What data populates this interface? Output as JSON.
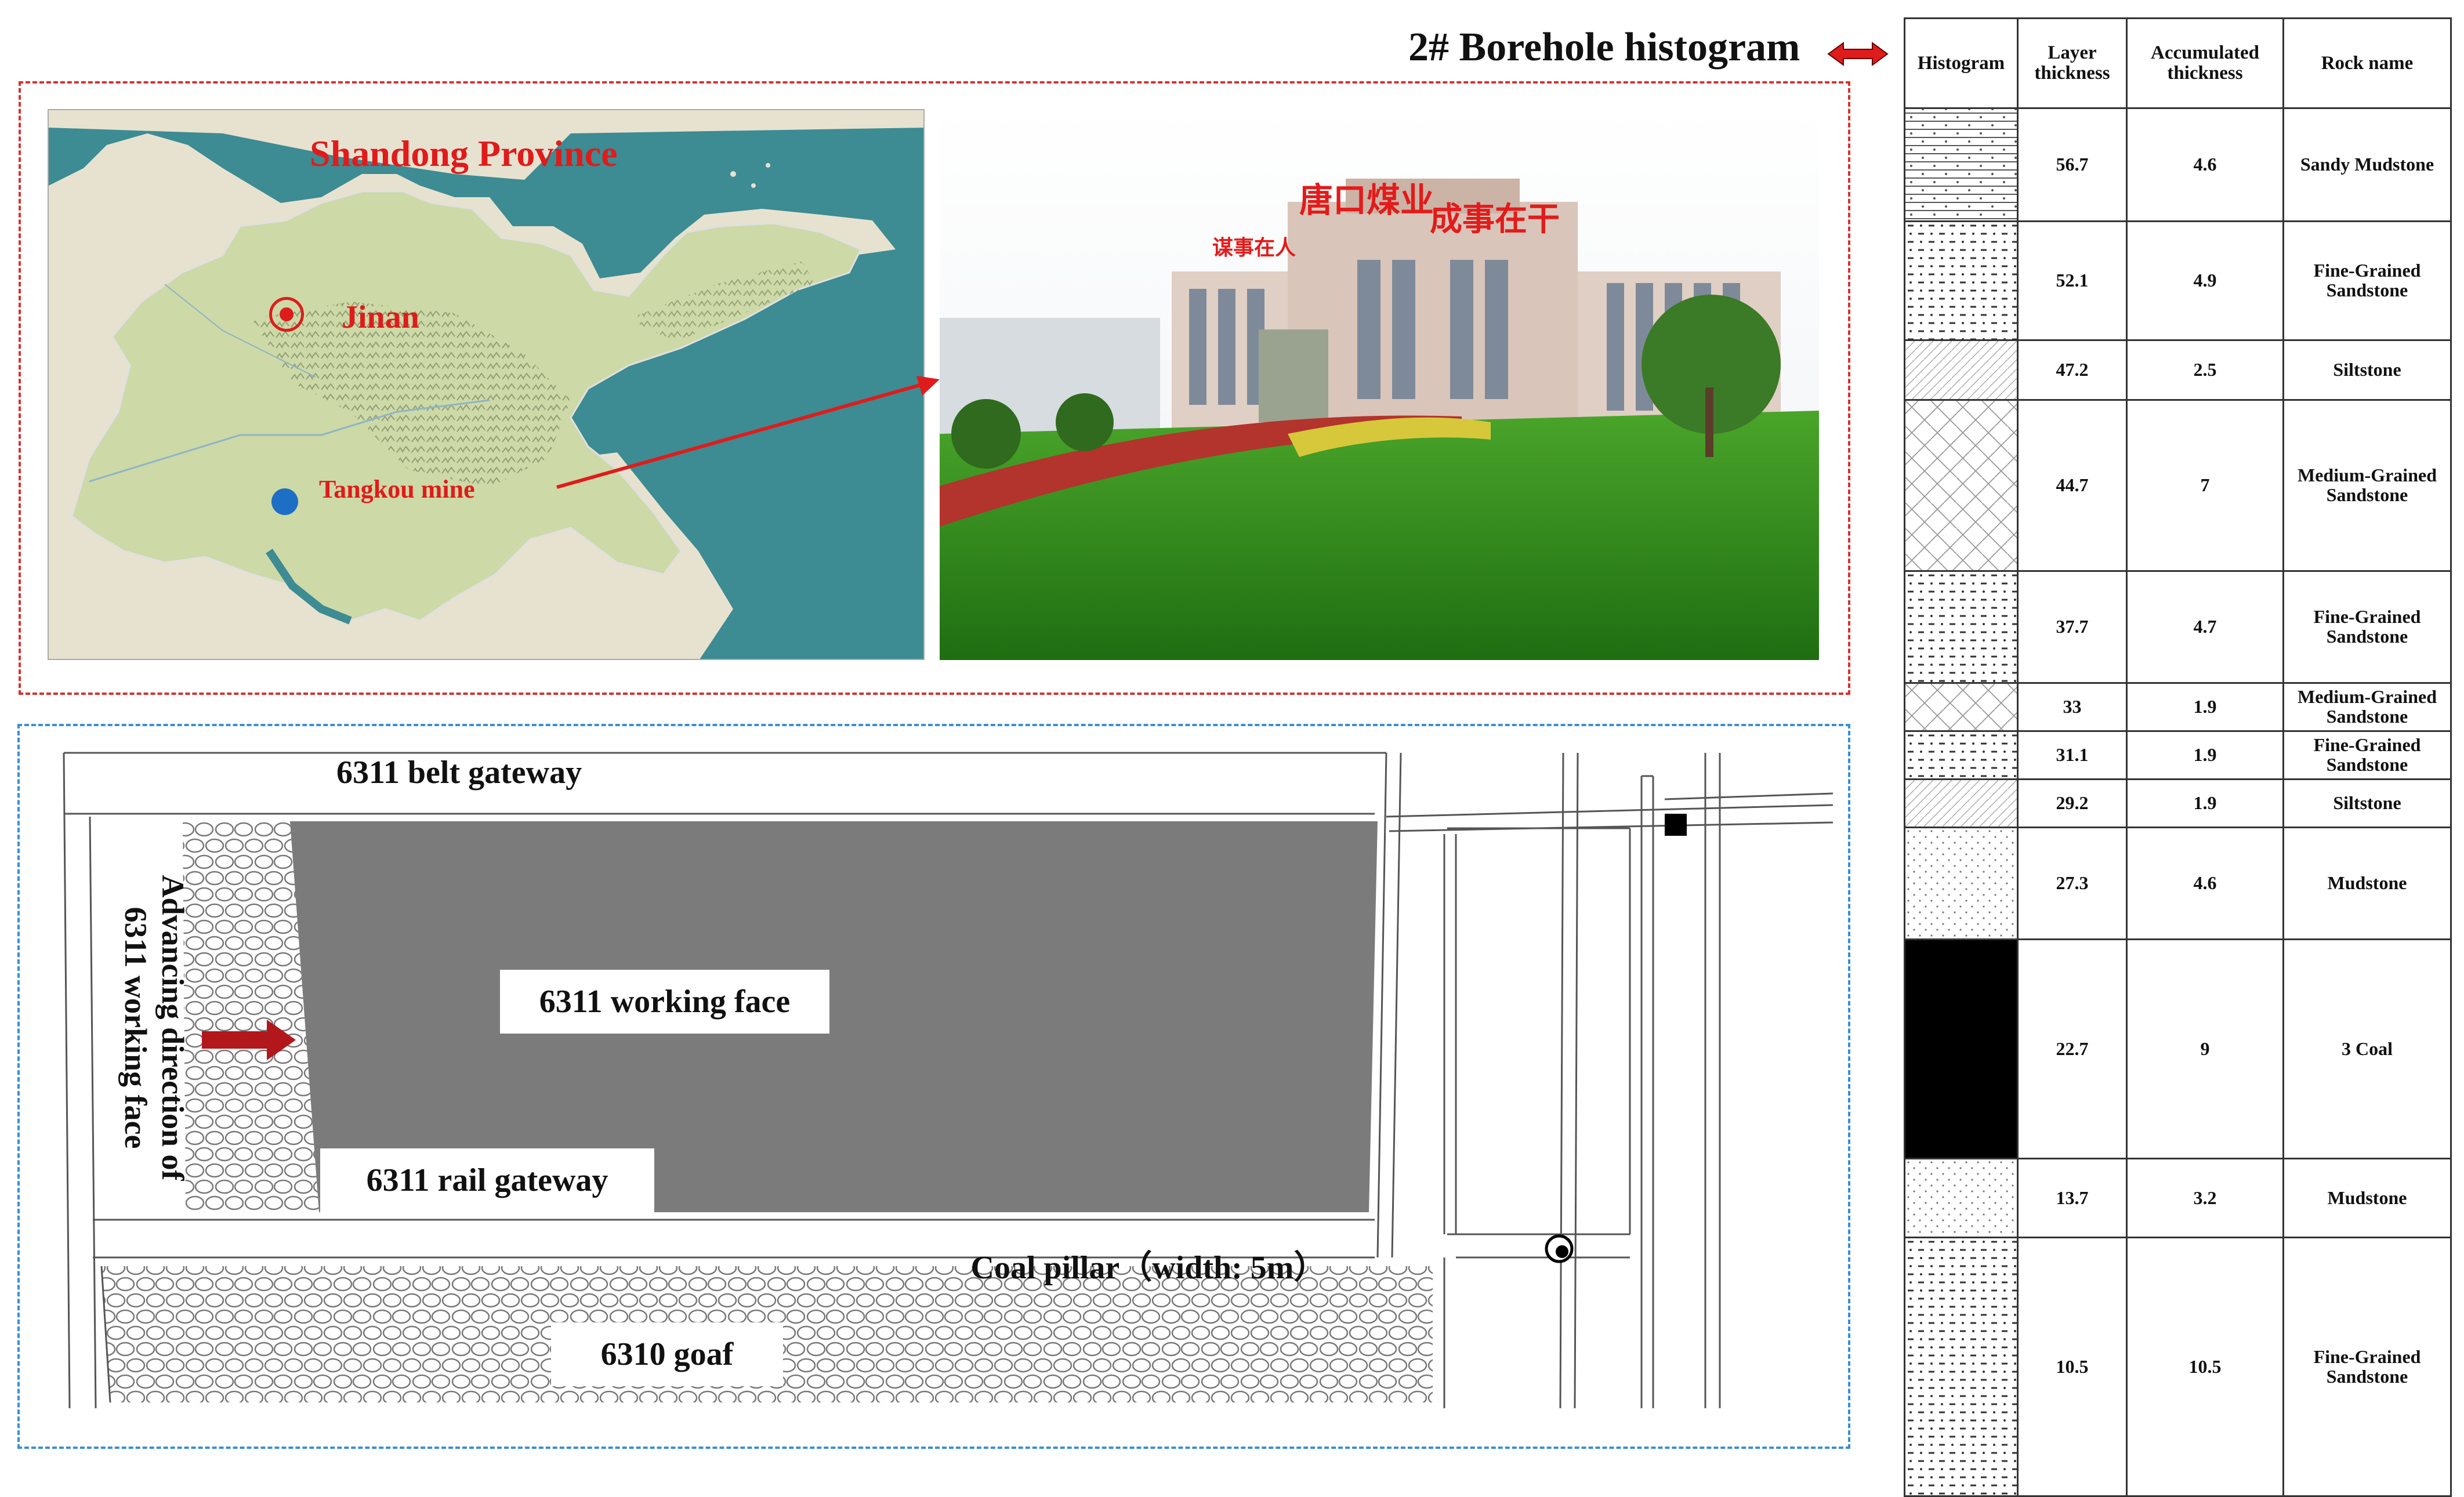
{
  "map": {
    "province_label": "Shandong Province",
    "capital_label": "Jinan",
    "mine_label": "Tangkou mine",
    "colors": {
      "sea": "#3d8b93",
      "land": "#cdd9a6",
      "marker_red": "#e01b1b",
      "marker_blue": "#1c6fc4"
    }
  },
  "photo": {
    "roof_sign": "唐口煤业",
    "slogan_left": "谋事在人",
    "slogan_right": "成事在干"
  },
  "plan": {
    "belt_gateway": "6311 belt gateway",
    "working_face": "6311 working face",
    "rail_gateway": "6311 rail gateway",
    "advancing_line1": "Advancing direction of",
    "advancing_line2": "6311 working face",
    "coal_pillar": "Coal pillar（width: 5m）",
    "goaf": "6310 goaf"
  },
  "borehole": {
    "title": "2# Borehole histogram",
    "headers": {
      "histogram": "Histogram",
      "layer": "Layer thickness",
      "accumulated": "Accumulated thickness",
      "rock": "Rock name"
    },
    "rows": [
      {
        "layer": "56.7",
        "accum": "4.6",
        "rock": "Sandy Mudstone",
        "pattern": "sandy-mudstone"
      },
      {
        "layer": "52.1",
        "accum": "4.9",
        "rock": "Fine-Grained Sandstone",
        "pattern": "fine-sandstone"
      },
      {
        "layer": "47.2",
        "accum": "2.5",
        "rock": "Siltstone",
        "pattern": "siltstone"
      },
      {
        "layer": "44.7",
        "accum": "7",
        "rock": "Medium-Grained Sandstone",
        "pattern": "medium-sandstone"
      },
      {
        "layer": "37.7",
        "accum": "4.7",
        "rock": "Fine-Grained Sandstone",
        "pattern": "fine-sandstone"
      },
      {
        "layer": "33",
        "accum": "1.9",
        "rock": "Medium-Grained Sandstone",
        "pattern": "medium-sandstone"
      },
      {
        "layer": "31.1",
        "accum": "1.9",
        "rock": "Fine-Grained Sandstone",
        "pattern": "fine-sandstone"
      },
      {
        "layer": "29.2",
        "accum": "1.9",
        "rock": "Siltstone",
        "pattern": "siltstone"
      },
      {
        "layer": "27.3",
        "accum": "4.6",
        "rock": "Mudstone",
        "pattern": "mudstone"
      },
      {
        "layer": "22.7",
        "accum": "9",
        "rock": "3 Coal",
        "pattern": "coal"
      },
      {
        "layer": "13.7",
        "accum": "3.2",
        "rock": "Mudstone",
        "pattern": "mudstone"
      },
      {
        "layer": "10.5",
        "accum": "10.5",
        "rock": "Fine-Grained Sandstone",
        "pattern": "fine-sandstone"
      }
    ]
  }
}
